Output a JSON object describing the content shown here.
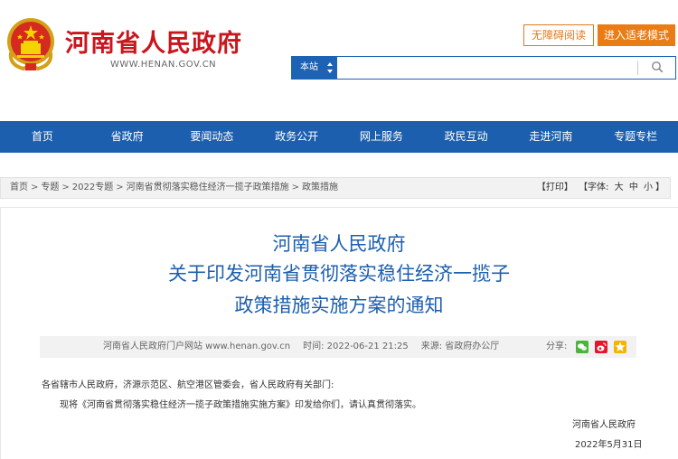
{
  "header": {
    "site_title": "河南省人民政府",
    "site_url": "WWW.HENAN.GOV.CN",
    "accessibility_label": "无障碍阅读",
    "elder_mode_label": "进入适老模式",
    "search_scope": "本站",
    "search_placeholder": "",
    "colors": {
      "brand_red": "#c8161d",
      "brand_blue": "#1c5fae",
      "accent_orange": "#ea7c15"
    }
  },
  "nav": {
    "items": [
      "首页",
      "省政府",
      "要闻动态",
      "政务公开",
      "网上服务",
      "政民互动",
      "走进河南",
      "专题专栏"
    ]
  },
  "breadcrumb": {
    "items": [
      "首页",
      "专题",
      "2022专题",
      "河南省贯彻落实稳住经济一揽子政策措施",
      "政策措施"
    ],
    "separator": ">",
    "print_label": "【打印】",
    "font_label": "【字体:",
    "font_large": "大",
    "font_medium": "中",
    "font_small": "小",
    "font_end": "】"
  },
  "article": {
    "title_lines": [
      "河南省人民政府",
      "关于印发河南省贯彻落实稳住经济一揽子",
      "政策措施实施方案的通知"
    ],
    "meta": {
      "source_site": "河南省人民政府门户网站 www.henan.gov.cn",
      "datetime": "时间: 2022-06-21 21:25",
      "origin": "来源: 省政府办公厅",
      "share_label": "分享:"
    },
    "recipients": "各省辖市人民政府，济源示范区、航空港区管委会，省人民政府有关部门:",
    "body": "现将《河南省贯彻落实稳住经济一揽子政策措施实施方案》印发给你们，请认真贯彻落实。",
    "signature": "河南省人民政府",
    "date": "2022年5月31日"
  }
}
